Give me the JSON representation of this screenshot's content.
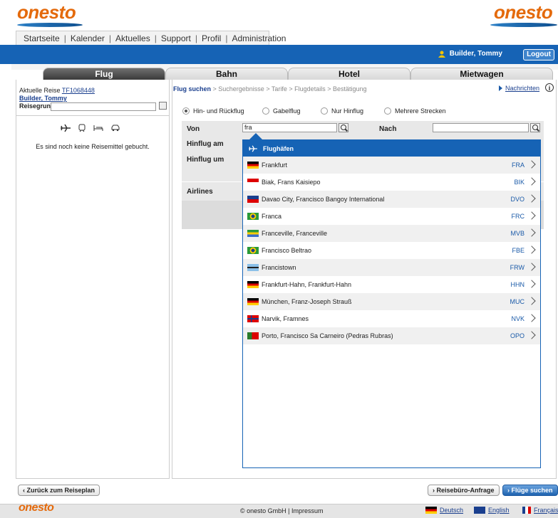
{
  "header": {
    "logo_left": "onesto",
    "logo_right": "onesto",
    "nav": [
      "Startseite",
      "Kalender",
      "Aktuelles",
      "Support",
      "Profil",
      "Administration"
    ],
    "user_name": "Builder, Tommy",
    "logout_label": "Logout"
  },
  "tabs": [
    {
      "label": "Flug",
      "active": true
    },
    {
      "label": "Bahn",
      "active": false
    },
    {
      "label": "Hotel",
      "active": false
    },
    {
      "label": "Mietwagen",
      "active": false
    }
  ],
  "left_panel": {
    "current_trip_label": "Aktuelle Reise",
    "trip_id": "TF1068448",
    "traveler": "Builder, Tommy",
    "reason_label": "Reisegrund",
    "reason_value": "",
    "empty_message": "Es sind noch keine Reisemittel gebucht."
  },
  "breadcrumb": {
    "active": "Flug suchen",
    "rest": " > Suchergebnisse > Tarife > Flugdetails > Bestätigung"
  },
  "messages_link": "Nachrichten",
  "trip_types": [
    {
      "label": "Hin- und Rückflug",
      "selected": true
    },
    {
      "label": "Gabelflug",
      "selected": false
    },
    {
      "label": "Nur Hinflug",
      "selected": false
    },
    {
      "label": "Mehrere Strecken",
      "selected": false
    }
  ],
  "form": {
    "from_label": "Von",
    "from_value": "fra",
    "to_label": "Nach",
    "to_value": "",
    "outbound_date_label": "Hinflug am",
    "outbound_time_label": "Hinflug um",
    "airlines_label": "Airlines"
  },
  "dropdown": {
    "header": "Flughäfen",
    "items": [
      {
        "name": "Frankfurt",
        "code": "FRA",
        "flag": "de"
      },
      {
        "name": "Biak, Frans Kaisiepo",
        "code": "BIK",
        "flag": "id"
      },
      {
        "name": "Davao City, Francisco Bangoy International",
        "code": "DVO",
        "flag": "ph"
      },
      {
        "name": "Franca",
        "code": "FRC",
        "flag": "br"
      },
      {
        "name": "Franceville, Franceville",
        "code": "MVB",
        "flag": "ga"
      },
      {
        "name": "Francisco Beltrao",
        "code": "FBE",
        "flag": "br"
      },
      {
        "name": "Francistown",
        "code": "FRW",
        "flag": "bw"
      },
      {
        "name": "Frankfurt-Hahn, Frankfurt-Hahn",
        "code": "HHN",
        "flag": "de"
      },
      {
        "name": "München, Franz-Joseph Strauß",
        "code": "MUC",
        "flag": "de"
      },
      {
        "name": "Narvik, Framnes",
        "code": "NVK",
        "flag": "no"
      },
      {
        "name": "Porto, Francisco Sa Carneiro (Pedras Rubras)",
        "code": "OPO",
        "flag": "pt"
      }
    ]
  },
  "buttons": {
    "back": "Zurück zum Reiseplan",
    "agency": "Reisebüro-Anfrage",
    "search": "Flüge suchen"
  },
  "footer": {
    "logo": "onesto",
    "copyright": "© onesto GmbH",
    "imprint": "Impressum",
    "languages": [
      "Deutsch",
      "English",
      "Français"
    ]
  },
  "colors": {
    "brand_blue": "#1663b5",
    "brand_orange": "#e46a0c"
  }
}
